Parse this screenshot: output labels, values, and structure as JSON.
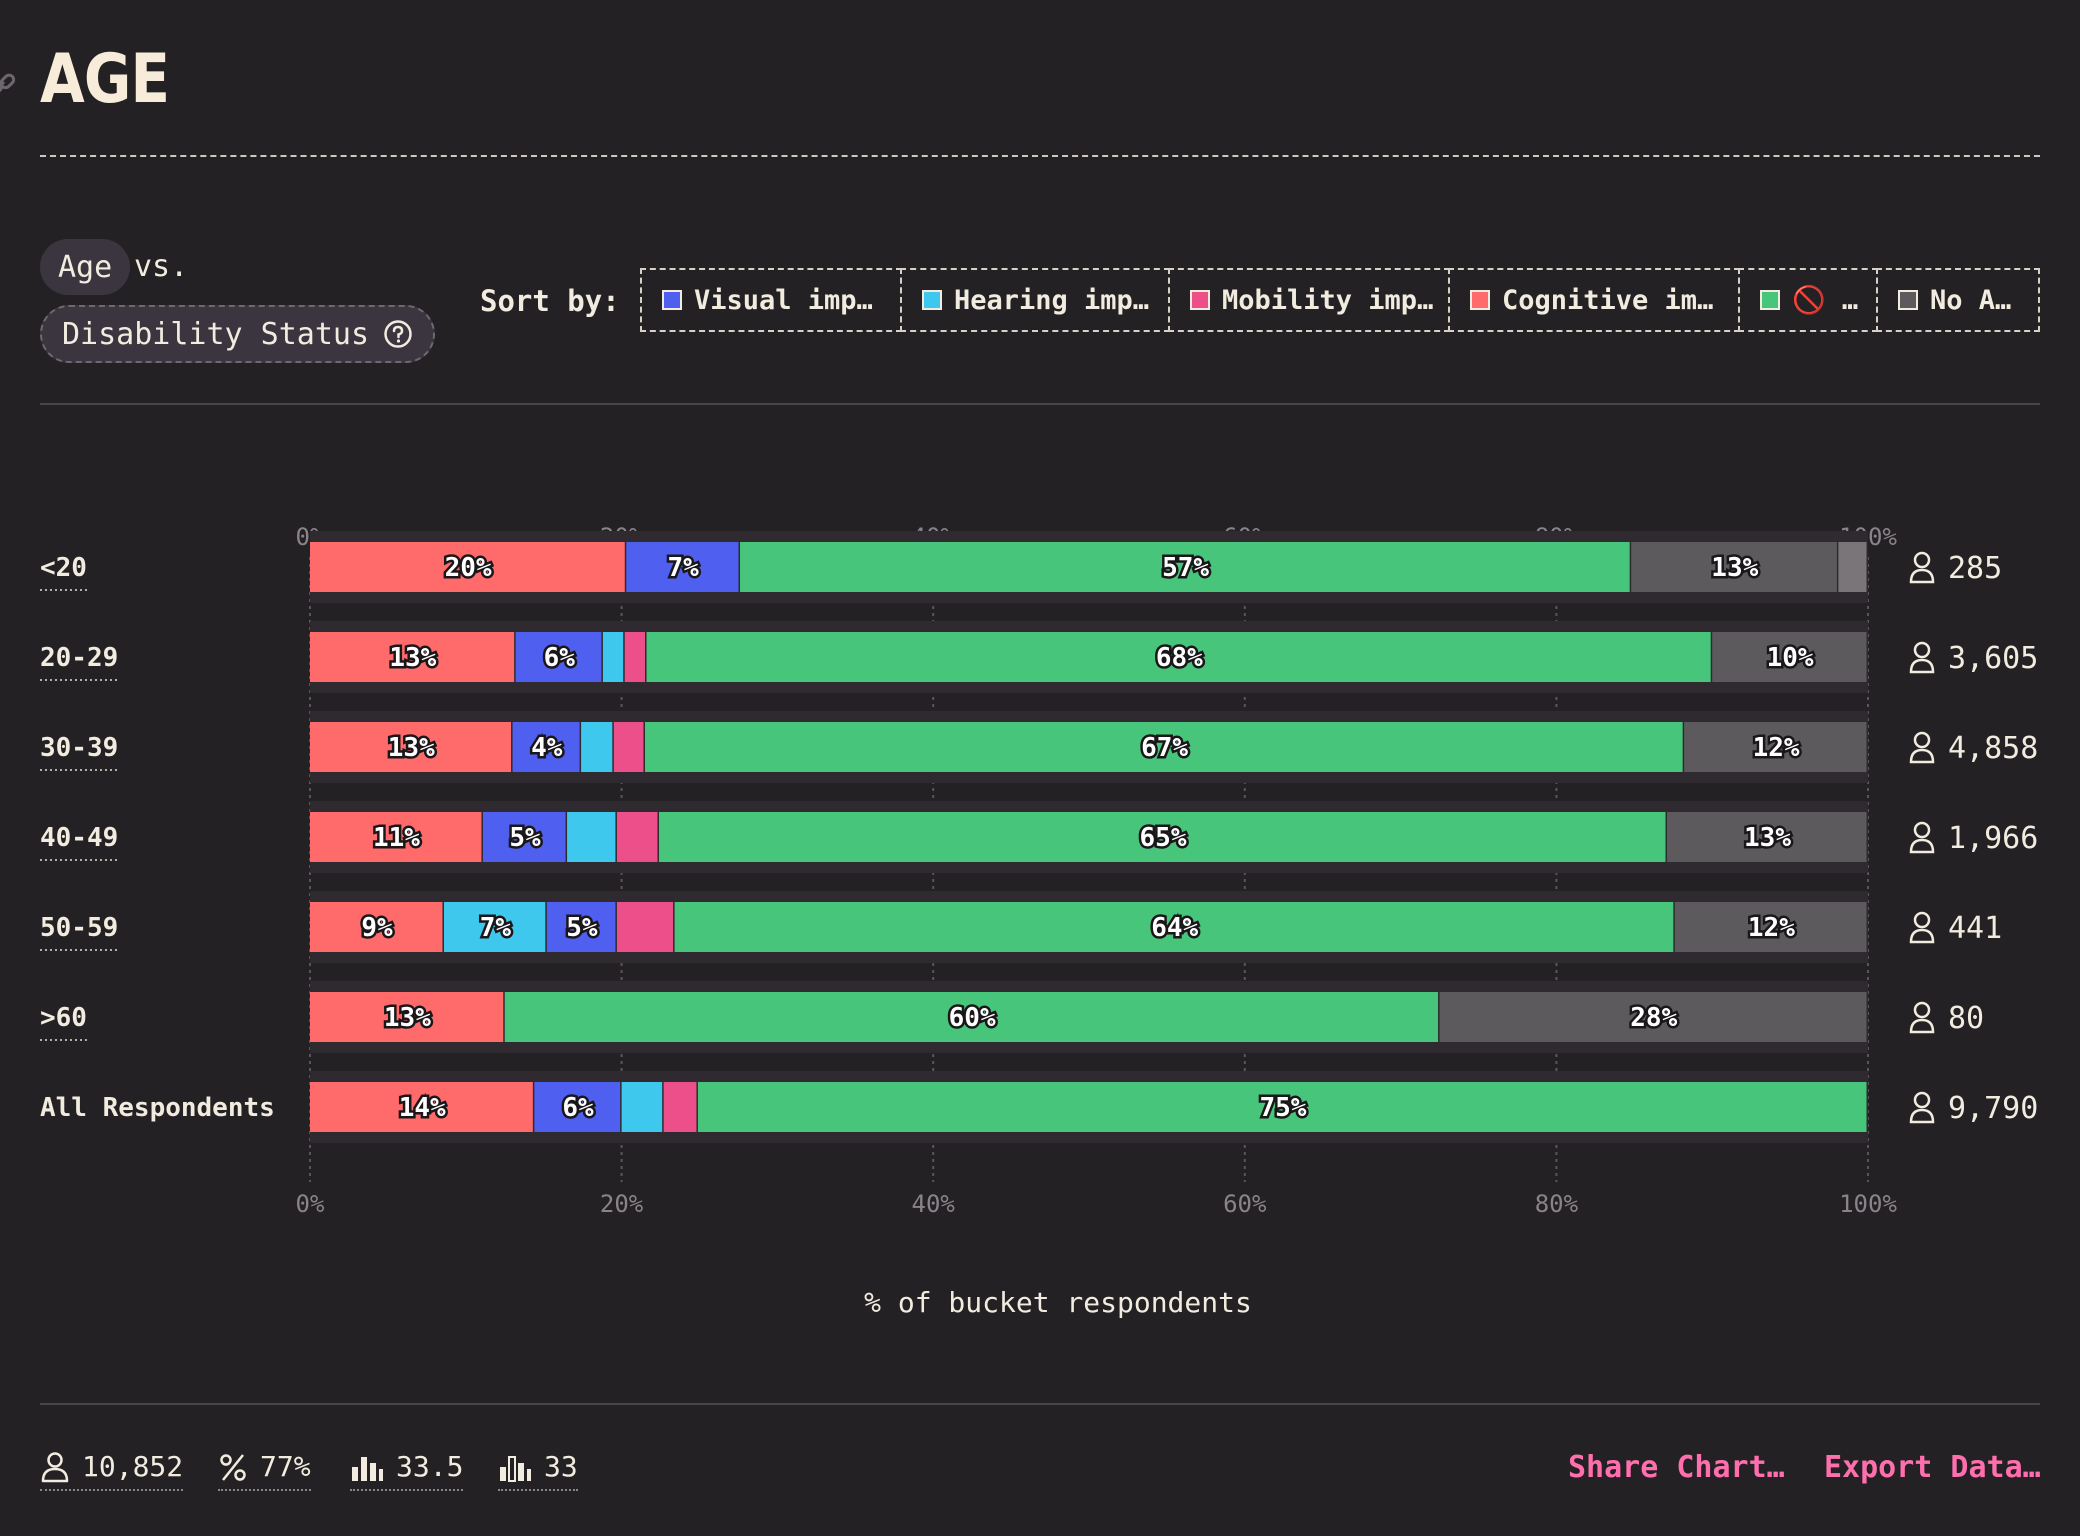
{
  "title": "AGE",
  "dimension_pill": "Age",
  "vs_text": "vs.",
  "status_pill": "Disability Status",
  "sort_label": "Sort by:",
  "sort_options": [
    {
      "label": "Visual imp…",
      "color": "#4f5ff0"
    },
    {
      "label": "Hearing imp…",
      "color": "#3ec8ee"
    },
    {
      "label": "Mobility imp…",
      "color": "#ec4f8a"
    },
    {
      "label": "Cognitive im…",
      "color": "#ff6a6a"
    },
    {
      "label": "🚫 …",
      "color": "#46c57b"
    },
    {
      "label": "No A…",
      "color": "#5d5a5e"
    }
  ],
  "chart_data": {
    "type": "bar",
    "orientation": "horizontal",
    "stacked": true,
    "xlabel": "% of bucket respondents",
    "xlim": [
      0,
      100
    ],
    "xticks": [
      "0%",
      "20%",
      "40%",
      "60%",
      "80%",
      "100%"
    ],
    "categories": [
      "<20",
      "20-29",
      "30-39",
      "40-49",
      "50-59",
      ">60",
      "All Respondents"
    ],
    "counts": [
      "285",
      "3,605",
      "4,858",
      "1,966",
      "441",
      "80",
      "9,790"
    ],
    "rows": [
      {
        "segments": [
          {
            "color": "#ff6a6a",
            "value": 20.3,
            "label": "20%"
          },
          {
            "color": "#4f5ff0",
            "value": 7.3,
            "label": "7%"
          },
          {
            "color": "#46c57b",
            "value": 57.2,
            "label": "57%"
          },
          {
            "color": "#5d5a5e",
            "value": 13.3,
            "label": "13%"
          },
          {
            "color": "#7a7579",
            "value": 1.9,
            "label": ""
          }
        ]
      },
      {
        "segments": [
          {
            "color": "#ff6a6a",
            "value": 13.2,
            "label": "13%"
          },
          {
            "color": "#4f5ff0",
            "value": 5.6,
            "label": "6%"
          },
          {
            "color": "#3ec8ee",
            "value": 1.4,
            "label": ""
          },
          {
            "color": "#ec4f8a",
            "value": 1.4,
            "label": ""
          },
          {
            "color": "#46c57b",
            "value": 68.4,
            "label": "68%"
          },
          {
            "color": "#5d5a5e",
            "value": 10.0,
            "label": "10%"
          }
        ]
      },
      {
        "segments": [
          {
            "color": "#ff6a6a",
            "value": 13.0,
            "label": "13%"
          },
          {
            "color": "#4f5ff0",
            "value": 4.4,
            "label": "4%"
          },
          {
            "color": "#3ec8ee",
            "value": 2.1,
            "label": ""
          },
          {
            "color": "#ec4f8a",
            "value": 2.0,
            "label": ""
          },
          {
            "color": "#46c57b",
            "value": 66.7,
            "label": "67%"
          },
          {
            "color": "#5d5a5e",
            "value": 11.8,
            "label": "12%"
          }
        ]
      },
      {
        "segments": [
          {
            "color": "#ff6a6a",
            "value": 11.1,
            "label": "11%"
          },
          {
            "color": "#4f5ff0",
            "value": 5.4,
            "label": "5%"
          },
          {
            "color": "#3ec8ee",
            "value": 3.2,
            "label": ""
          },
          {
            "color": "#ec4f8a",
            "value": 2.7,
            "label": ""
          },
          {
            "color": "#46c57b",
            "value": 64.7,
            "label": "65%"
          },
          {
            "color": "#5d5a5e",
            "value": 12.9,
            "label": "13%"
          }
        ]
      },
      {
        "segments": [
          {
            "color": "#ff6a6a",
            "value": 8.6,
            "label": "9%"
          },
          {
            "color": "#3ec8ee",
            "value": 6.6,
            "label": "7%"
          },
          {
            "color": "#4f5ff0",
            "value": 4.5,
            "label": "5%"
          },
          {
            "color": "#ec4f8a",
            "value": 3.7,
            "label": ""
          },
          {
            "color": "#46c57b",
            "value": 64.2,
            "label": "64%"
          },
          {
            "color": "#5d5a5e",
            "value": 12.4,
            "label": "12%"
          }
        ]
      },
      {
        "segments": [
          {
            "color": "#ff6a6a",
            "value": 12.5,
            "label": "13%"
          },
          {
            "color": "#46c57b",
            "value": 60.0,
            "label": "60%"
          },
          {
            "color": "#5d5a5e",
            "value": 27.5,
            "label": "28%"
          }
        ]
      },
      {
        "segments": [
          {
            "color": "#ff6a6a",
            "value": 14.4,
            "label": "14%"
          },
          {
            "color": "#4f5ff0",
            "value": 5.6,
            "label": "6%"
          },
          {
            "color": "#3ec8ee",
            "value": 2.7,
            "label": ""
          },
          {
            "color": "#ec4f8a",
            "value": 2.2,
            "label": ""
          },
          {
            "color": "#46c57b",
            "value": 75.1,
            "label": "75%"
          }
        ]
      }
    ]
  },
  "footer": {
    "stats": [
      {
        "icon": "person-icon",
        "value": "10,852"
      },
      {
        "icon": "percent-icon",
        "value": "77%"
      },
      {
        "icon": "average-icon",
        "value": "33.5"
      },
      {
        "icon": "median-icon",
        "value": "33"
      }
    ],
    "share_label": "Share Chart…",
    "export_label": "Export Data…",
    "accent": "#ff6fae"
  }
}
